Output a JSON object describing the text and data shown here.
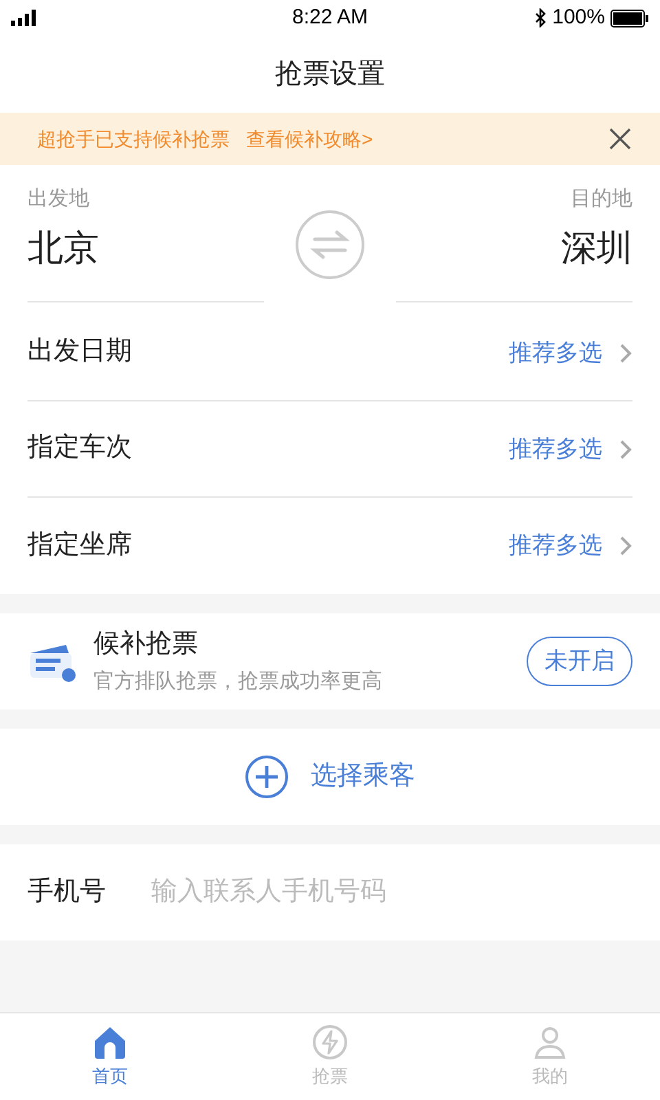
{
  "status_bar": {
    "time": "8:22 AM",
    "battery": "100%"
  },
  "title": "抢票设置",
  "notice": {
    "text": "超抢手已支持候补抢票",
    "link": "查看候补攻略>"
  },
  "route": {
    "from_label": "出发地",
    "from": "北京",
    "to_label": "目的地",
    "to": "深圳"
  },
  "options": [
    {
      "label": "出发日期",
      "value": "推荐多选"
    },
    {
      "label": "指定车次",
      "value": "推荐多选"
    },
    {
      "label": "指定坐席",
      "value": "推荐多选"
    }
  ],
  "waitlist": {
    "title": "候补抢票",
    "subtitle": "官方排队抢票，抢票成功率更高",
    "button": "未开启",
    "on": false
  },
  "passenger_button": "选择乘客",
  "phone": {
    "label": "手机号",
    "placeholder": "输入联系人手机号码"
  },
  "tabs": [
    {
      "label": "首页",
      "kind": "home",
      "selected": true
    },
    {
      "label": "抢票",
      "kind": "grab",
      "selected": false
    },
    {
      "label": "我的",
      "kind": "profile",
      "selected": false
    }
  ]
}
